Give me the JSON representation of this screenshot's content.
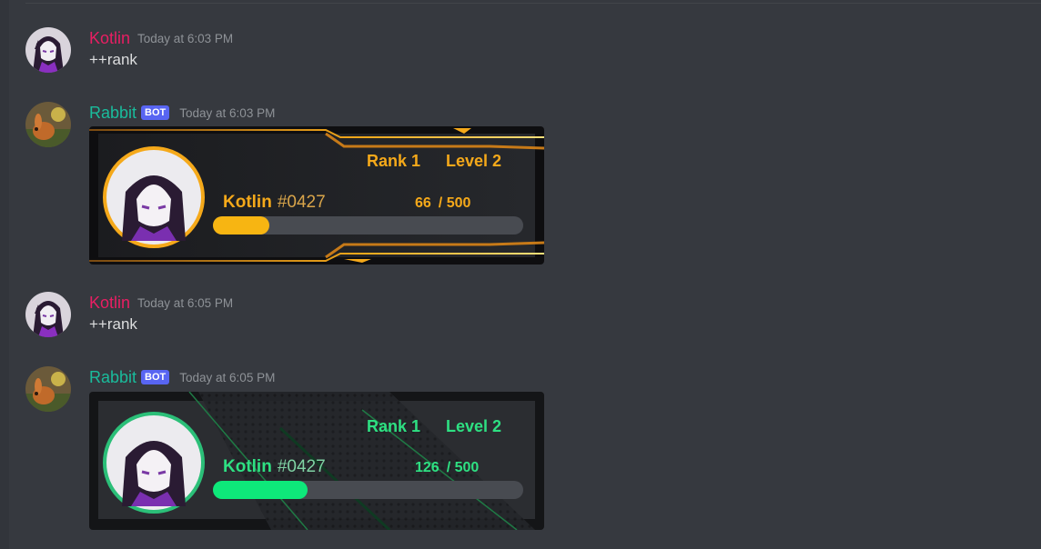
{
  "messages": [
    {
      "author": "Kotlin",
      "is_bot": false,
      "timestamp": "Today at 6:03 PM",
      "content": "++rank"
    },
    {
      "author": "Rabbit",
      "is_bot": true,
      "bot_tag": "BOT",
      "timestamp": "Today at 6:03 PM",
      "rank_card": {
        "theme": "gold",
        "accent_color": "#f5a91a",
        "bar_color": "#f7b512",
        "rank_label": "Rank",
        "rank_value": "1",
        "level_label": "Level",
        "level_value": "2",
        "username": "Kotlin",
        "discriminator": "#0427",
        "current_xp": "66",
        "max_xp": "/ 500",
        "xp_fraction": 0.132
      }
    },
    {
      "author": "Kotlin",
      "is_bot": false,
      "timestamp": "Today at 6:05 PM",
      "content": "++rank"
    },
    {
      "author": "Rabbit",
      "is_bot": true,
      "bot_tag": "BOT",
      "timestamp": "Today at 6:05 PM",
      "rank_card": {
        "theme": "green",
        "accent_color": "#2ecc71",
        "bar_color": "#0ee87a",
        "rank_label": "Rank",
        "rank_value": "1",
        "level_label": "Level",
        "level_value": "2",
        "username": "Kotlin",
        "discriminator": "#0427",
        "current_xp": "126",
        "max_xp": "/ 500",
        "xp_fraction": 0.252
      }
    }
  ],
  "colors": {
    "background": "#36393f",
    "user_name": "#e91e63",
    "bot_name": "#1abc9c",
    "bot_tag": "#5865f2",
    "timestamp": "#8e9297",
    "message_text": "#dcddde"
  },
  "icons": {
    "user_avatar": "anime-avatar-icon",
    "bot_avatar": "rabbit-avatar-icon"
  }
}
